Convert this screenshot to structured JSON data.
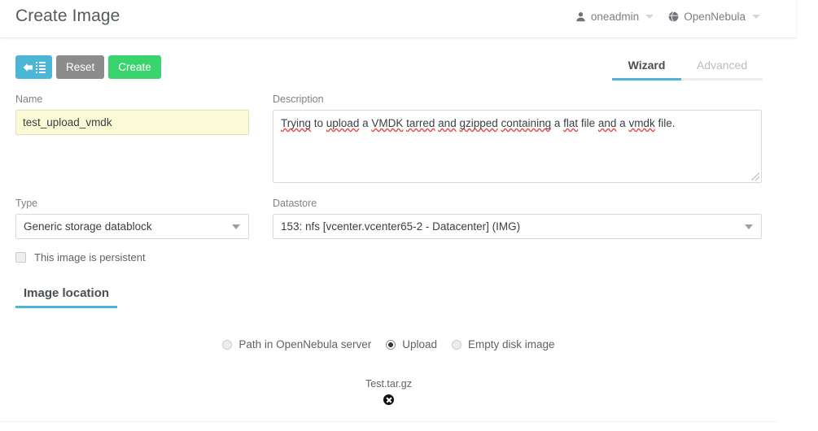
{
  "header": {
    "title": "Create Image",
    "user_menu": {
      "label": "oneadmin",
      "icon": "user-icon"
    },
    "zone_menu": {
      "label": "OpenNebula",
      "icon": "globe-icon"
    }
  },
  "toolbar": {
    "back_label": "",
    "back_icon": "arrow-left-list-icon",
    "reset_label": "Reset",
    "create_label": "Create",
    "colors": {
      "back": "#4bb6d6",
      "reset": "#8c8c8c",
      "create": "#3ad46f"
    }
  },
  "mode_tabs": {
    "wizard_label": "Wizard",
    "advanced_label": "Advanced",
    "active": "Wizard",
    "accent": "#4bb6d6"
  },
  "form": {
    "name": {
      "label": "Name",
      "value": "test_upload_vmdk",
      "placeholder": "",
      "background": "#fafad7"
    },
    "description": {
      "label": "Description",
      "value": "Trying to upload a VMDK tarred and gzipped containing a flat file and a vmdk file.",
      "spellcheck_words": [
        "Trying",
        "upload",
        "VMDK",
        "tarred",
        "and",
        "gzipped",
        "containing",
        "flat",
        "and",
        "vmdk"
      ],
      "segments": [
        {
          "text": "Trying",
          "misspelled": true
        },
        {
          "text": " to ",
          "misspelled": false
        },
        {
          "text": "upload",
          "misspelled": true
        },
        {
          "text": " a ",
          "misspelled": false
        },
        {
          "text": "VMDK",
          "misspelled": true
        },
        {
          "text": " ",
          "misspelled": false
        },
        {
          "text": "tarred",
          "misspelled": true
        },
        {
          "text": " ",
          "misspelled": false
        },
        {
          "text": "and",
          "misspelled": true
        },
        {
          "text": " ",
          "misspelled": false
        },
        {
          "text": "gzipped",
          "misspelled": true
        },
        {
          "text": " ",
          "misspelled": false
        },
        {
          "text": "containing",
          "misspelled": true
        },
        {
          "text": " a ",
          "misspelled": false
        },
        {
          "text": "flat",
          "misspelled": true
        },
        {
          "text": " file ",
          "misspelled": false
        },
        {
          "text": "and",
          "misspelled": true
        },
        {
          "text": " a ",
          "misspelled": false
        },
        {
          "text": "vmdk",
          "misspelled": true
        },
        {
          "text": " file.",
          "misspelled": false
        }
      ]
    },
    "type": {
      "label": "Type",
      "value": "Generic storage datablock"
    },
    "datastore": {
      "label": "Datastore",
      "value": "153: nfs [vcenter.vcenter65-2 - Datacenter] (IMG)"
    },
    "persistent": {
      "label": "This image is persistent",
      "checked": false
    }
  },
  "image_location": {
    "tab_label": "Image location",
    "options": [
      {
        "label": "Path in OpenNebula server",
        "selected": false
      },
      {
        "label": "Upload",
        "selected": true
      },
      {
        "label": "Empty disk image",
        "selected": false
      }
    ],
    "upload": {
      "file_name": "Test.tar.gz",
      "remove_icon": "remove-circle-x-icon"
    }
  }
}
